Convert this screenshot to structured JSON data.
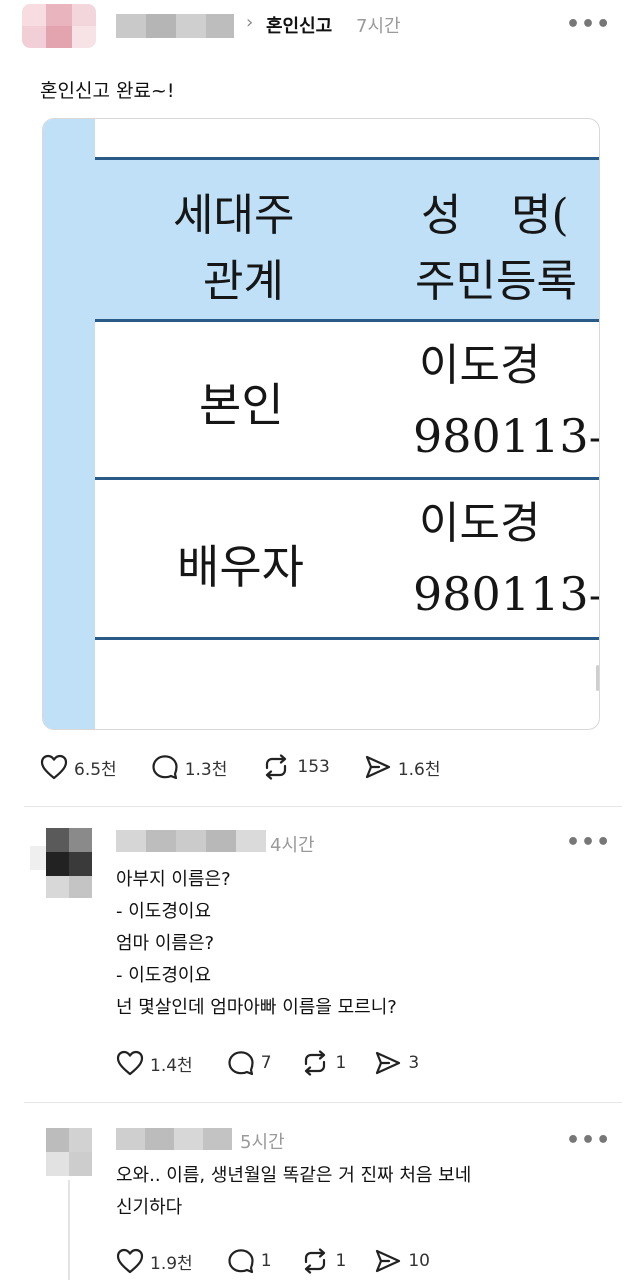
{
  "post": {
    "community_sep": "›",
    "community": "혼인신고",
    "time": "7시간",
    "more": "•••",
    "text": "혼인신고 완료~!",
    "document": {
      "headers": [
        "세대주",
        "관계",
        "성",
        "명(",
        "주민등록"
      ],
      "rows": [
        {
          "relation": "본인",
          "name": "이도경",
          "number": "980113–"
        },
        {
          "relation": "배우자",
          "name": "이도경",
          "number": "980113–"
        }
      ]
    },
    "actions": {
      "likes": "6.5천",
      "comments": "1.3천",
      "reposts": "153",
      "shares": "1.6천"
    }
  },
  "comments": [
    {
      "time": "4시간",
      "more": "•••",
      "lines": [
        "아부지 이름은?",
        "- 이도경이요",
        "엄마 이름은?",
        "- 이도경이요",
        "넌 몇살인데 엄마아빠 이름을 모르니?"
      ],
      "actions": {
        "likes": "1.4천",
        "comments": "7",
        "reposts": "1",
        "shares": "3"
      }
    },
    {
      "time": "5시간",
      "more": "•••",
      "lines": [
        "오와.. 이름, 생년월일 똑같은 거 진짜 처음 보네",
        "신기하다"
      ],
      "actions": {
        "likes": "1.9천",
        "comments": "1",
        "reposts": "1",
        "shares": "10"
      }
    }
  ],
  "icons": [
    "heart-icon",
    "comment-icon",
    "repost-icon",
    "share-icon",
    "more-icon",
    "chevron-right-icon"
  ]
}
